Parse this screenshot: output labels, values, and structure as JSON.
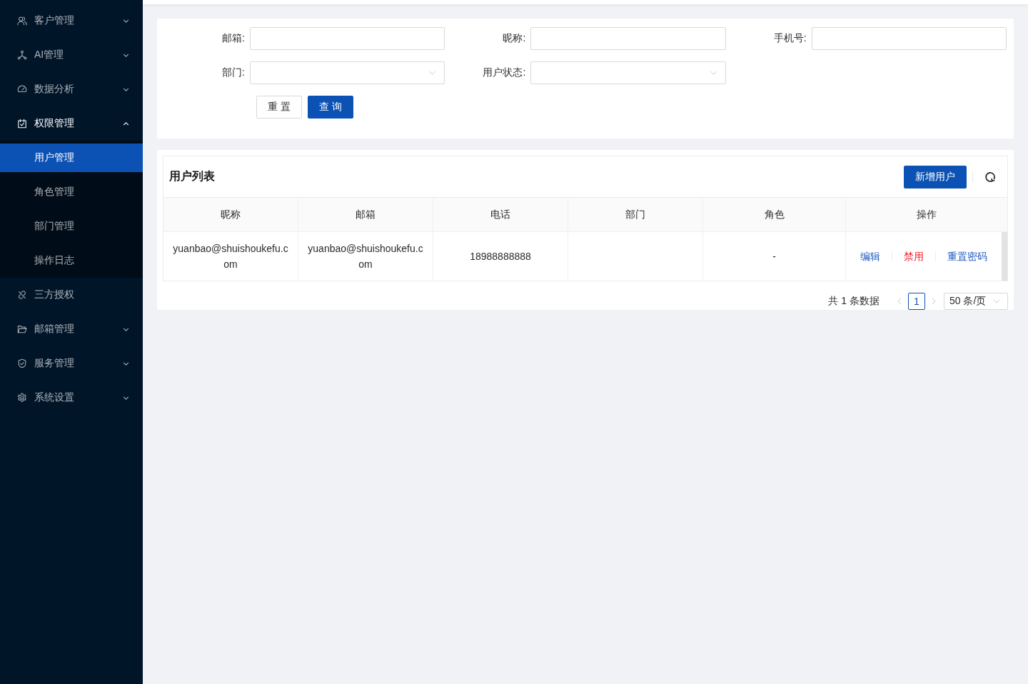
{
  "sidebar": {
    "items": [
      {
        "kind": "group",
        "label": "客户管理",
        "expanded": false
      },
      {
        "kind": "group",
        "label": "AI管理",
        "expanded": false
      },
      {
        "kind": "group",
        "label": "数据分析",
        "expanded": false
      },
      {
        "kind": "group",
        "label": "权限管理",
        "expanded": true,
        "children": [
          {
            "label": "用户管理",
            "selected": true
          },
          {
            "label": "角色管理",
            "selected": false
          },
          {
            "label": "部门管理",
            "selected": false
          },
          {
            "label": "操作日志",
            "selected": false
          }
        ]
      },
      {
        "kind": "link",
        "label": "三方授权",
        "selected": false
      },
      {
        "kind": "group",
        "label": "邮箱管理",
        "expanded": false
      },
      {
        "kind": "group",
        "label": "服务管理",
        "expanded": false
      },
      {
        "kind": "group",
        "label": "系统设置",
        "expanded": false
      }
    ]
  },
  "search_form": {
    "fields": [
      {
        "kind": "input",
        "label": "邮箱:"
      },
      {
        "kind": "input",
        "label": "昵称:"
      },
      {
        "kind": "input",
        "label": "手机号:"
      },
      {
        "kind": "select",
        "label": "部门:"
      },
      {
        "kind": "select",
        "label": "用户状态:"
      }
    ],
    "buttons": [
      {
        "kind": "default",
        "label": "重 置"
      },
      {
        "kind": "primary",
        "label": "查 询"
      }
    ]
  },
  "user_list": {
    "title": "用户列表",
    "add_button": "新增用户",
    "table": {
      "columns": [
        "昵称",
        "邮箱",
        "电话",
        "部门",
        "角色",
        "操作"
      ],
      "rows": [
        {
          "nickname": "yuanbao@shuishoukefu.com",
          "email": "yuanbao@shuishoukefu.com",
          "phone": "18988888888",
          "role": "-",
          "actions": [
            {
              "kind": "link",
              "label": "编辑"
            },
            {
              "kind": "danger",
              "label": "禁用"
            },
            {
              "kind": "link",
              "label": "重置密码"
            }
          ]
        }
      ]
    },
    "pagination": {
      "total": "共 1 条数据",
      "prev_disabled": true,
      "pages": [
        {
          "label": "1",
          "selected": true
        }
      ],
      "next_disabled": true,
      "page_size": "50 条/页"
    }
  }
}
